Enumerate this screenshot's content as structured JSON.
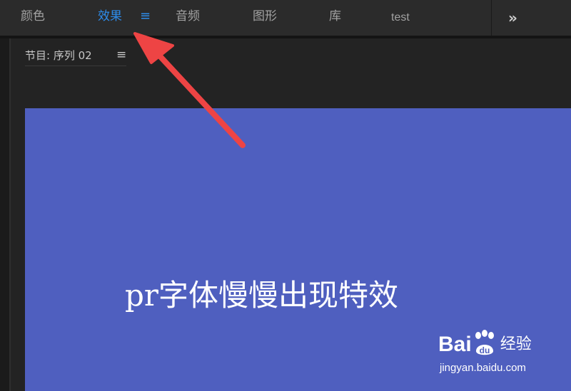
{
  "workspace_tabs": [
    {
      "label": "颜色",
      "active": false
    },
    {
      "label": "效果",
      "active": true
    },
    {
      "label": "音频",
      "active": false
    },
    {
      "label": "图形",
      "active": false
    },
    {
      "label": "库",
      "active": false
    },
    {
      "label": "test",
      "active": false
    }
  ],
  "active_tab_menu_icon": "hamburger-menu-icon",
  "overflow_icon": "double-chevron-right-icon",
  "overflow_glyph": "»",
  "panel": {
    "title": "节目: 序列 02",
    "menu_icon": "hamburger-menu-icon"
  },
  "canvas": {
    "text": "pr字体慢慢出现特效",
    "background_color": "#4f5fbf",
    "text_color": "#ffffff"
  },
  "watermark": {
    "brand_left": "Bai",
    "brand_right": "du",
    "brand_cn": "经验",
    "url": "jingyan.baidu.com"
  },
  "annotation": {
    "type": "arrow",
    "color": "#ee4444",
    "points_to": "workspace-tab-effects"
  },
  "colors": {
    "active_tab": "#2d8ceb",
    "inactive_tab": "#a2a2a2",
    "topbar_bg": "#2b2b2b",
    "panel_bg": "#232323"
  }
}
